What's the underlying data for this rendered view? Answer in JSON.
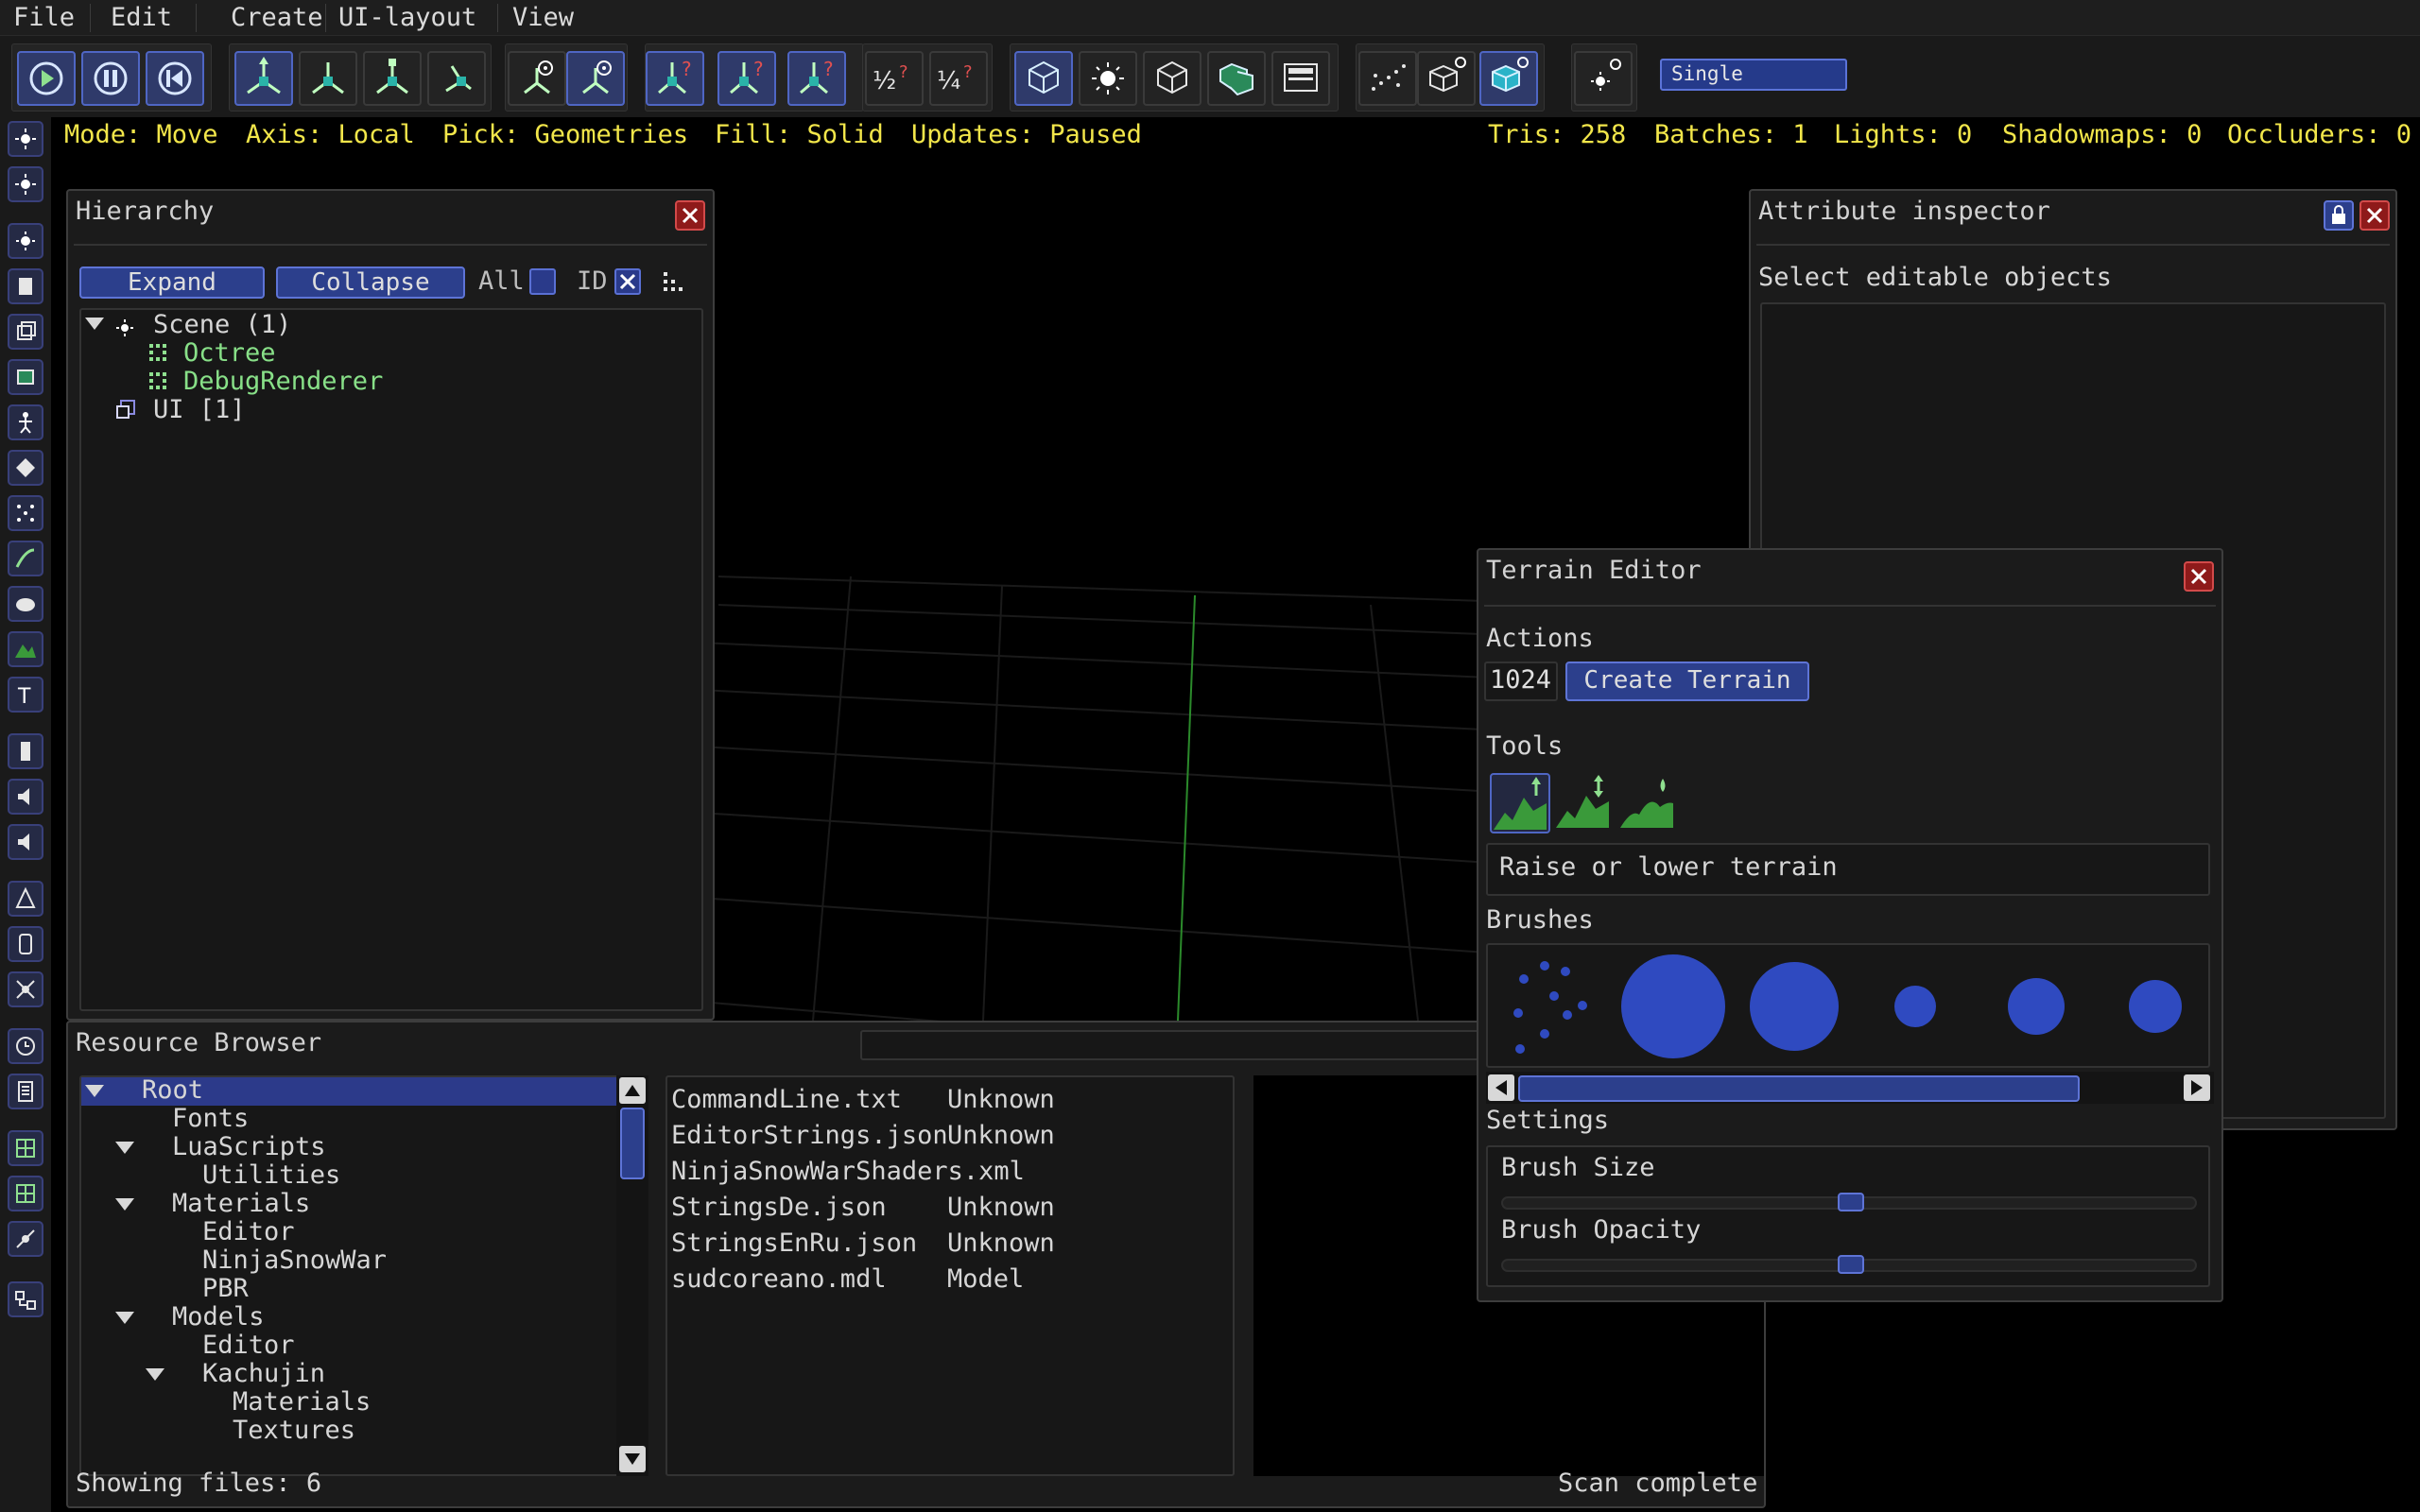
{
  "menu": [
    "File",
    "Edit",
    "Create",
    "UI-layout",
    "View"
  ],
  "toolbar": {
    "viewport_mode": "Single",
    "buttons": [
      "play-icon",
      "pause-icon",
      "restart-icon",
      "move-icon",
      "rotate-icon",
      "scale-icon",
      "select-icon",
      "local-axis-icon",
      "world-axis-icon",
      "snap-move-icon",
      "snap-rotate-icon",
      "snap-scale-icon",
      "half-snap-icon",
      "quarter-snap-icon",
      "pick-geometry-icon",
      "pick-light-icon",
      "pick-zone-icon",
      "pick-rigidbody-icon",
      "pick-ui-icon",
      "fill-point-icon",
      "fill-wireframe-icon",
      "fill-solid-icon",
      "light-visibility-icon"
    ]
  },
  "status": {
    "mode": "Mode: Move",
    "axis": "Axis: Local",
    "pick": "Pick: Geometries",
    "fill": "Fill: Solid",
    "updates": "Updates: Paused",
    "tris": "Tris: 258",
    "batches": "Batches: 1",
    "lights": "Lights: 0",
    "shadowmaps": "Shadowmaps: 0",
    "occluders": "Occluders: 0"
  },
  "hierarchy": {
    "title": "Hierarchy",
    "expand_label": "Expand",
    "collapse_label": "Collapse",
    "all_label": "All",
    "id_label": "ID",
    "items": [
      {
        "label": "Scene (1)",
        "icon": "scene-icon"
      },
      {
        "label": "Octree",
        "icon": "component-icon"
      },
      {
        "label": "DebugRenderer",
        "icon": "component-icon"
      },
      {
        "label": "UI [1]",
        "icon": "ui-element-icon"
      }
    ]
  },
  "attribute_inspector": {
    "title": "Attribute inspector",
    "message": "Select editable objects"
  },
  "terrain_editor": {
    "title": "Terrain Editor",
    "actions_label": "Actions",
    "size_value": "1024",
    "create_label": "Create Terrain",
    "tools_label": "Tools",
    "tools": [
      "raise-terrain-icon",
      "set-height-icon",
      "smooth-terrain-icon"
    ],
    "tool_description": "Raise or lower terrain",
    "brushes_label": "Brushes",
    "brushes": [
      "noise-brush-icon",
      "large-brush-icon",
      "medium-large-brush-icon",
      "small-brush-icon",
      "medium-brush-icon",
      "medium-small-brush-icon"
    ],
    "settings_label": "Settings",
    "brush_size_label": "Brush Size",
    "brush_opacity_label": "Brush Opacity",
    "brush_size_value": 0.5,
    "brush_opacity_value": 0.5
  },
  "resource_browser": {
    "title": "Resource Browser",
    "folders": [
      {
        "label": "Root",
        "expanded": true,
        "selected": true
      },
      {
        "label": "Fonts"
      },
      {
        "label": "LuaScripts",
        "expanded": true
      },
      {
        "label": "Utilities"
      },
      {
        "label": "Materials",
        "expanded": true
      },
      {
        "label": "Editor"
      },
      {
        "label": "NinjaSnowWar"
      },
      {
        "label": "PBR"
      },
      {
        "label": "Models",
        "expanded": true
      },
      {
        "label": "Editor"
      },
      {
        "label": "Kachujin",
        "expanded": true
      },
      {
        "label": "Materials"
      },
      {
        "label": "Textures"
      }
    ],
    "files": [
      {
        "name": "CommandLine.txt",
        "type": "Unknown"
      },
      {
        "name": "EditorStrings.json",
        "type": "Unknown"
      },
      {
        "name": "NinjaSnowWarShaders.xml",
        "type": ""
      },
      {
        "name": "StringsDe.json",
        "type": "Unknown"
      },
      {
        "name": "StringsEnRu.json",
        "type": "Unknown"
      },
      {
        "name": "sudcoreano.mdl",
        "type": "Model"
      }
    ],
    "showing_files": "Showing files: 6",
    "scan_status": "Scan complete"
  }
}
